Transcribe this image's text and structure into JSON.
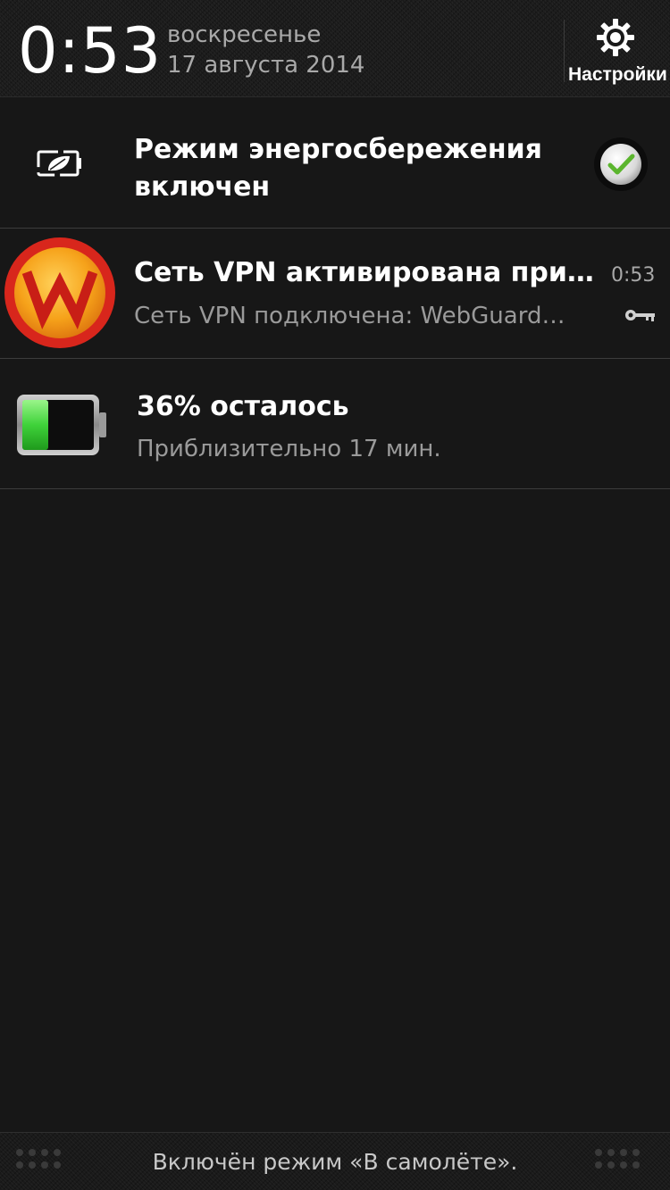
{
  "header": {
    "time": "0:53",
    "weekday": "воскресенье",
    "date": "17 августа 2014",
    "settings_label": "Настройки",
    "settings_icon": "gear-icon"
  },
  "notifications": [
    {
      "icon": "power-saving-leaf-icon",
      "title_line1": "Режим энергосбережения",
      "title_line2": "включен",
      "status_icon": "checkmark-icon",
      "checked": true
    },
    {
      "icon": "webguard-w-icon",
      "title": "Сеть VPN активирована при…",
      "subtitle": "Сеть VPN подключена: WebGuard…",
      "time": "0:53",
      "status_icon": "key-icon"
    },
    {
      "icon": "battery-icon",
      "title": "36% осталось",
      "subtitle": "Приблизительно 17 мин.",
      "battery_level": 0.36
    }
  ],
  "footer": {
    "text": "Включён режим «В самолёте»."
  },
  "colors": {
    "background": "#171717",
    "title": "#ffffff",
    "subtitle": "#9a9a9a",
    "battery_green": "#3fd23a",
    "webguard_red": "#d8261c",
    "webguard_gold": "#f6a21a",
    "check_green": "#5bb52e"
  }
}
